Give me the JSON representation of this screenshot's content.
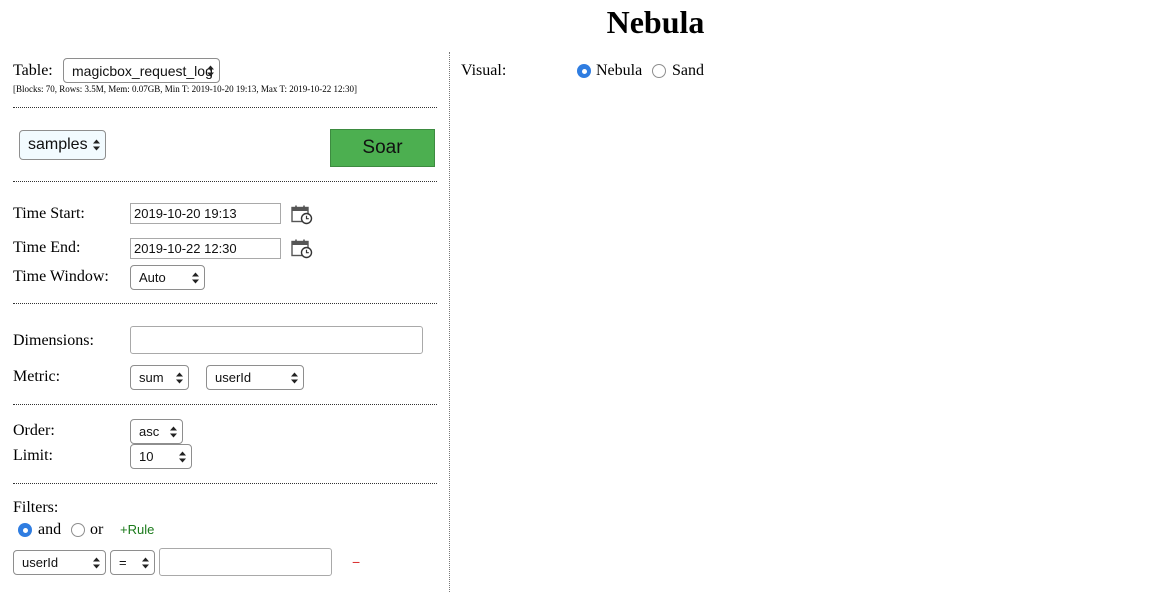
{
  "app_title": "Nebula",
  "table": {
    "label": "Table:",
    "selected": "magicbox_request_log",
    "meta": "[Blocks: 70, Rows: 3.5M, Mem: 0.07GB, Min T: 2019-10-20 19:13, Max T: 2019-10-22 12:30]"
  },
  "mode_select": "samples",
  "soar_label": "Soar",
  "time": {
    "start_label": "Time Start:",
    "start_value": "2019-10-20 19:13",
    "end_label": "Time End:",
    "end_value": "2019-10-22 12:30",
    "window_label": "Time Window:",
    "window_value": "Auto"
  },
  "dimensions": {
    "label": "Dimensions:",
    "value": ""
  },
  "metric": {
    "label": "Metric:",
    "agg": "sum",
    "field": "userId"
  },
  "order": {
    "label": "Order:",
    "value": "asc"
  },
  "limit": {
    "label": "Limit:",
    "value": "10"
  },
  "filters": {
    "label": "Filters:",
    "and_label": "and",
    "or_label": "or",
    "selected_logic": "and",
    "add_rule_label": "+Rule",
    "rule": {
      "field": "userId",
      "op": "=",
      "value": ""
    },
    "remove_label": "−"
  },
  "visual": {
    "label": "Visual:",
    "options": [
      "Nebula",
      "Sand"
    ],
    "selected": "Nebula"
  },
  "icons": {
    "calendar": "calendar-clock-icon",
    "select_arrows": "updown-arrows-icon"
  },
  "colors": {
    "soar_button": "#4caf50",
    "radio_selected": "#2f7de1",
    "rule_link": "#1a7a1a",
    "remove_link": "#d92b2b"
  }
}
